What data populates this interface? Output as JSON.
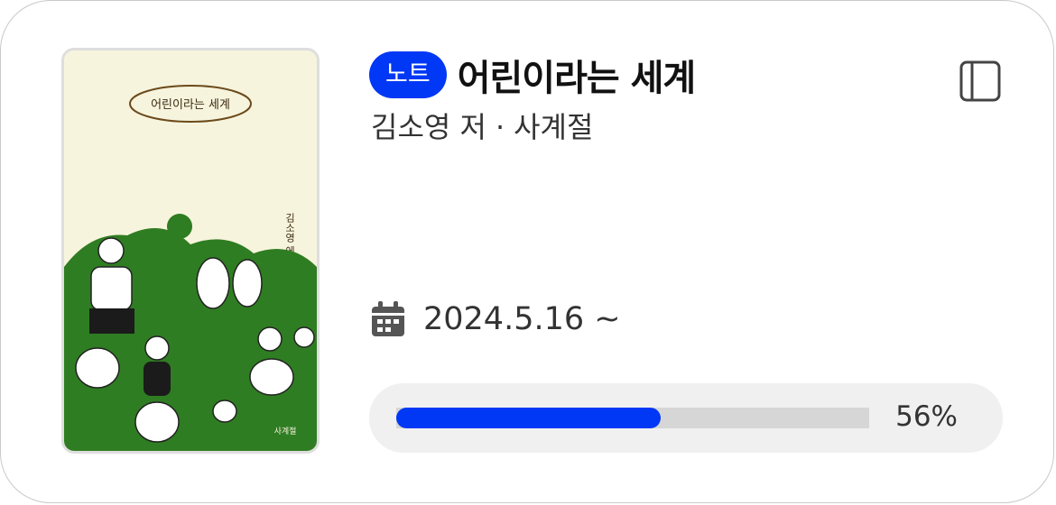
{
  "book": {
    "badge": "노트",
    "title": "어린이라는 세계",
    "author": "김소영 저",
    "separator": "·",
    "publisher": "사계절",
    "cover_title": "어린이라는 세계",
    "cover_author": "김소영 에세이",
    "cover_publisher": "사계절"
  },
  "reading": {
    "start_date": "2024.5.16 ~",
    "progress_label": "56%",
    "progress_fraction": 0.56
  },
  "icons": {
    "bookmark": "book-icon",
    "calendar": "calendar-icon"
  },
  "colors": {
    "accent": "#0038f5",
    "cover_green": "#2f7d22",
    "cover_cream": "#f7f4dd"
  }
}
